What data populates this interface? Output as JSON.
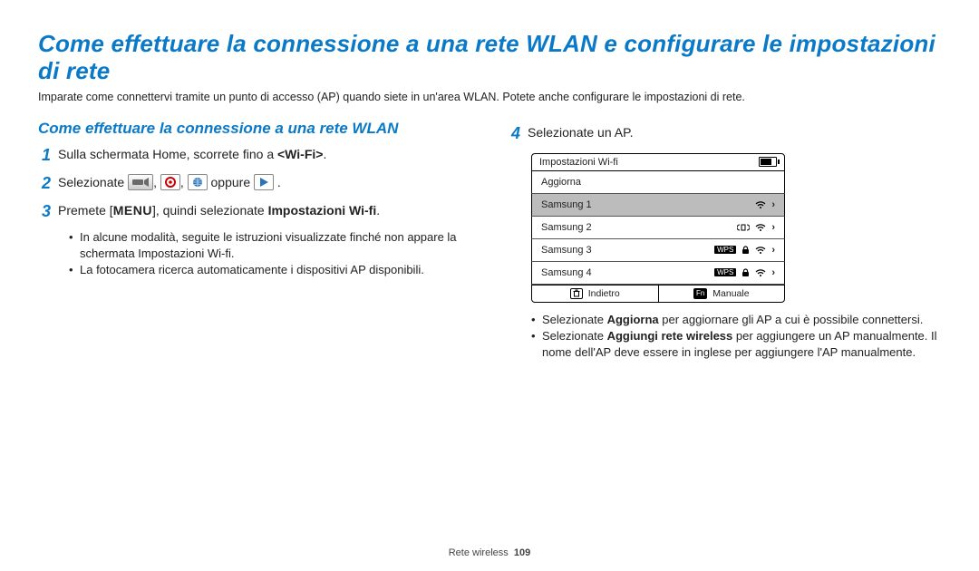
{
  "title": "Come effettuare la connessione a una rete WLAN e configurare le impostazioni di rete",
  "intro": "Imparate come connettervi tramite un punto di accesso (AP) quando siete in un'area WLAN. Potete anche configurare le impostazioni di rete.",
  "section_title": "Come effettuare la connessione a una rete WLAN",
  "steps": {
    "1": {
      "text_a": "Sulla schermata Home, scorrete fino a ",
      "text_b": "<Wi-Fi>",
      "text_c": "."
    },
    "2": {
      "prefix": "Selezionate ",
      "sep": ", ",
      "or": "oppure ",
      "end": " ."
    },
    "3": {
      "prefix": "Premete [",
      "menu": "MENU",
      "mid": "], quindi selezionate ",
      "bold": "Impostazioni Wi-fi",
      "end": ".",
      "sub": [
        "In alcune modalità, seguite le istruzioni visualizzate finché non appare la schermata Impostazioni Wi-fi.",
        "La fotocamera ricerca automaticamente i dispositivi AP disponibili."
      ]
    },
    "4": {
      "text": "Selezionate un AP."
    }
  },
  "screen": {
    "title": "Impostazioni Wi-fi",
    "rows": [
      {
        "label": "Aggiorna",
        "icons": []
      },
      {
        "label": "Samsung 1",
        "selected": true,
        "icons": [
          "wifi",
          "chev"
        ]
      },
      {
        "label": "Samsung 2",
        "icons": [
          "phone",
          "wifi",
          "chev"
        ]
      },
      {
        "label": "Samsung 3",
        "icons": [
          "wps",
          "lock",
          "wifi",
          "chev"
        ]
      },
      {
        "label": "Samsung 4",
        "icons": [
          "wps",
          "lock",
          "wifi",
          "chev"
        ]
      }
    ],
    "footer": {
      "back": "Indietro",
      "manual": "Manuale"
    }
  },
  "post_bullets": [
    {
      "a": "Selezionate ",
      "b": "Aggiorna",
      "c": " per aggiornare gli AP a cui è possibile connettersi."
    },
    {
      "a": "Selezionate ",
      "b": "Aggiungi rete wireless",
      "c": " per aggiungere un AP manualmente. Il nome dell'AP deve essere in inglese per aggiungere l'AP manualmente."
    }
  ],
  "footer": {
    "section": "Rete wireless",
    "page": "109"
  }
}
